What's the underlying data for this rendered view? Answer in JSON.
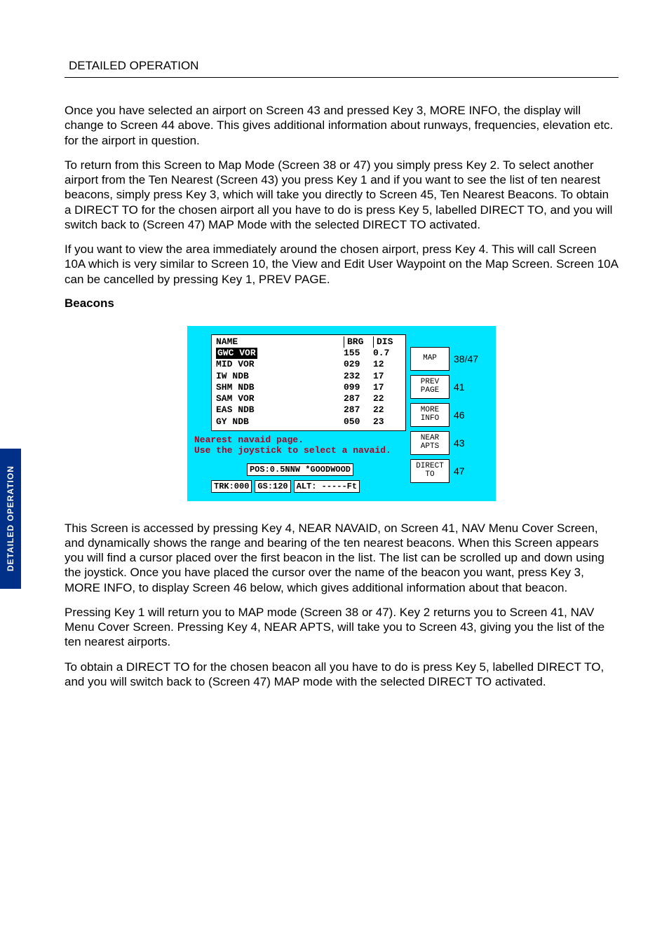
{
  "tab_label": "DETAILED OPERATION",
  "section_header": "DETAILED OPERATION",
  "paragraphs": {
    "p1": "Once you have selected an airport on Screen 43 and pressed Key 3, MORE INFO, the display will change to Screen 44 above.  This gives additional information about runways, frequencies, elevation etc. for the airport in question.",
    "p2": "To return from this Screen to Map Mode (Screen 38 or 47) you simply press Key 2. To select another airport from the Ten Nearest (Screen 43) you press Key 1 and if you want to see the list of ten nearest beacons, simply press Key 3, which will take you directly to Screen 45, Ten Nearest Beacons. To obtain a DIRECT TO for the chosen airport all you have to do is press Key 5, labelled DIRECT TO, and you will switch back to (Screen 47) MAP Mode with the selected DIRECT TO activated.",
    "p3": "If you want to view the area immediately around the chosen airport, press Key 4. This will call Screen 10A which is very similar to Screen 10, the View and Edit User Waypoint on the Map Screen.  Screen 10A can be cancelled by pressing Key 1, PREV PAGE.",
    "p4": "This Screen is accessed by pressing Key 4, NEAR NAVAID, on Screen 41, NAV Menu Cover Screen, and dynamically shows the range and bearing of the ten nearest beacons. When this Screen appears you will find a cursor placed over the first beacon in the list. The list can be scrolled up and down using the joystick.  Once you have placed the cursor over the name of the beacon you want, press Key 3, MORE INFO, to display Screen 46 below, which gives additional information about that beacon.",
    "p5": "Pressing Key 1 will return you to MAP mode (Screen 38 or 47).  Key 2 returns you to Screen 41, NAV Menu Cover Screen.  Pressing Key 4, NEAR APTS, will take you to Screen 43, giving you the list of the ten nearest airports.",
    "p6": "To obtain a DIRECT TO for the chosen beacon all you have to do is press Key 5, labelled DIRECT TO, and you will switch back to (Screen 47) MAP mode with the selected DIRECT TO activated."
  },
  "sub_heading": "Beacons",
  "screen": {
    "headers": {
      "name": "NAME",
      "brg": "BRG",
      "dis": "DIS"
    },
    "rows": [
      {
        "name_a": "GWC",
        "name_b": "VOR",
        "brg": "155",
        "dis": "0.7",
        "selected": true
      },
      {
        "name": "MID VOR",
        "brg": "029",
        "dis": "12"
      },
      {
        "name": "IW NDB",
        "brg": "232",
        "dis": "17"
      },
      {
        "name": "SHM NDB",
        "brg": "099",
        "dis": "17"
      },
      {
        "name": "SAM VOR",
        "brg": "287",
        "dis": "22"
      },
      {
        "name": "EAS NDB",
        "brg": "287",
        "dis": "22"
      },
      {
        "name": "GY NDB",
        "brg": "050",
        "dis": "23"
      }
    ],
    "hint1": "Nearest navaid page.",
    "hint2": "Use the joystick to select a navaid.",
    "pos": "POS:0.5NNW *GOODWOOD",
    "trk": "TRK:000",
    "gs": "GS:120",
    "alt": "ALT: -----Ft",
    "keys": [
      {
        "label": "MAP",
        "num": "38/47"
      },
      {
        "label": "PREV\nPAGE",
        "num": "41"
      },
      {
        "label": "MORE\nINFO",
        "num": "46"
      },
      {
        "label": "NEAR\nAPTS",
        "num": "43"
      },
      {
        "label": "DIRECT\nTO",
        "num": "47"
      }
    ]
  }
}
